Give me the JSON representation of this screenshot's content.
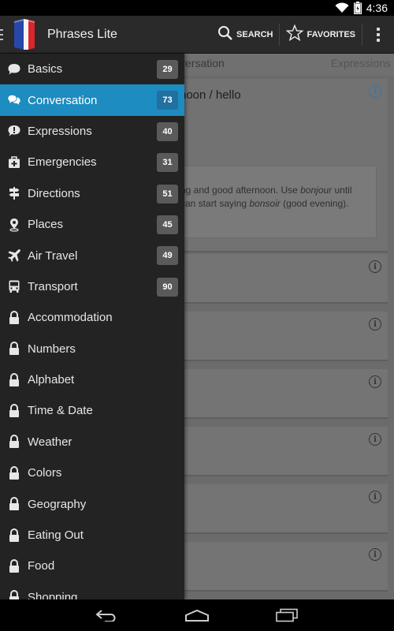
{
  "status_bar": {
    "time": "4:36",
    "icons": [
      "wifi-icon",
      "battery-icon"
    ]
  },
  "action_bar": {
    "title": "Phrases Lite",
    "search_label": "SEARCH",
    "favorites_label": "FAVORITES",
    "icons": [
      "drawer-indicator-icon",
      "french-flag-app-icon",
      "search-icon",
      "star-icon",
      "overflow-menu-icon"
    ]
  },
  "background": {
    "tab_current": "versation",
    "tab_next": "Expressions",
    "card_title": "noon / hello",
    "note_line1_a": "ng and good afternoon. Use ",
    "note_line1_b": "bonjour",
    "note_line1_c": " until",
    "note_line2_a": "can start saying ",
    "note_line2_b": "bonsoir",
    "note_line2_c": " (good evening)."
  },
  "drawer": {
    "items": [
      {
        "label": "Basics",
        "count": "29",
        "icon": "speech-bubble-icon"
      },
      {
        "label": "Conversation",
        "count": "73",
        "icon": "conversation-icon",
        "active": true
      },
      {
        "label": "Expressions",
        "count": "40",
        "icon": "exclamation-bubble-icon"
      },
      {
        "label": "Emergencies",
        "count": "31",
        "icon": "first-aid-icon"
      },
      {
        "label": "Directions",
        "count": "51",
        "icon": "signpost-icon"
      },
      {
        "label": "Places",
        "count": "45",
        "icon": "map-pin-icon"
      },
      {
        "label": "Air Travel",
        "count": "49",
        "icon": "airplane-icon"
      },
      {
        "label": "Transport",
        "count": "90",
        "icon": "bus-icon"
      },
      {
        "label": "Accommodation",
        "icon": "lock-icon"
      },
      {
        "label": "Numbers",
        "icon": "lock-icon"
      },
      {
        "label": "Alphabet",
        "icon": "lock-icon"
      },
      {
        "label": "Time & Date",
        "icon": "lock-icon"
      },
      {
        "label": "Weather",
        "icon": "lock-icon"
      },
      {
        "label": "Colors",
        "icon": "lock-icon"
      },
      {
        "label": "Geography",
        "icon": "lock-icon"
      },
      {
        "label": "Eating Out",
        "icon": "lock-icon"
      },
      {
        "label": "Food",
        "icon": "lock-icon"
      },
      {
        "label": "Shopping",
        "icon": "lock-icon"
      }
    ]
  },
  "nav_bar": {
    "icons": [
      "back-icon",
      "home-icon",
      "recents-icon"
    ]
  },
  "colors": {
    "accent": "#1d8cc0",
    "drawer_bg": "#232323",
    "badge_bg": "#5a5a5a"
  }
}
